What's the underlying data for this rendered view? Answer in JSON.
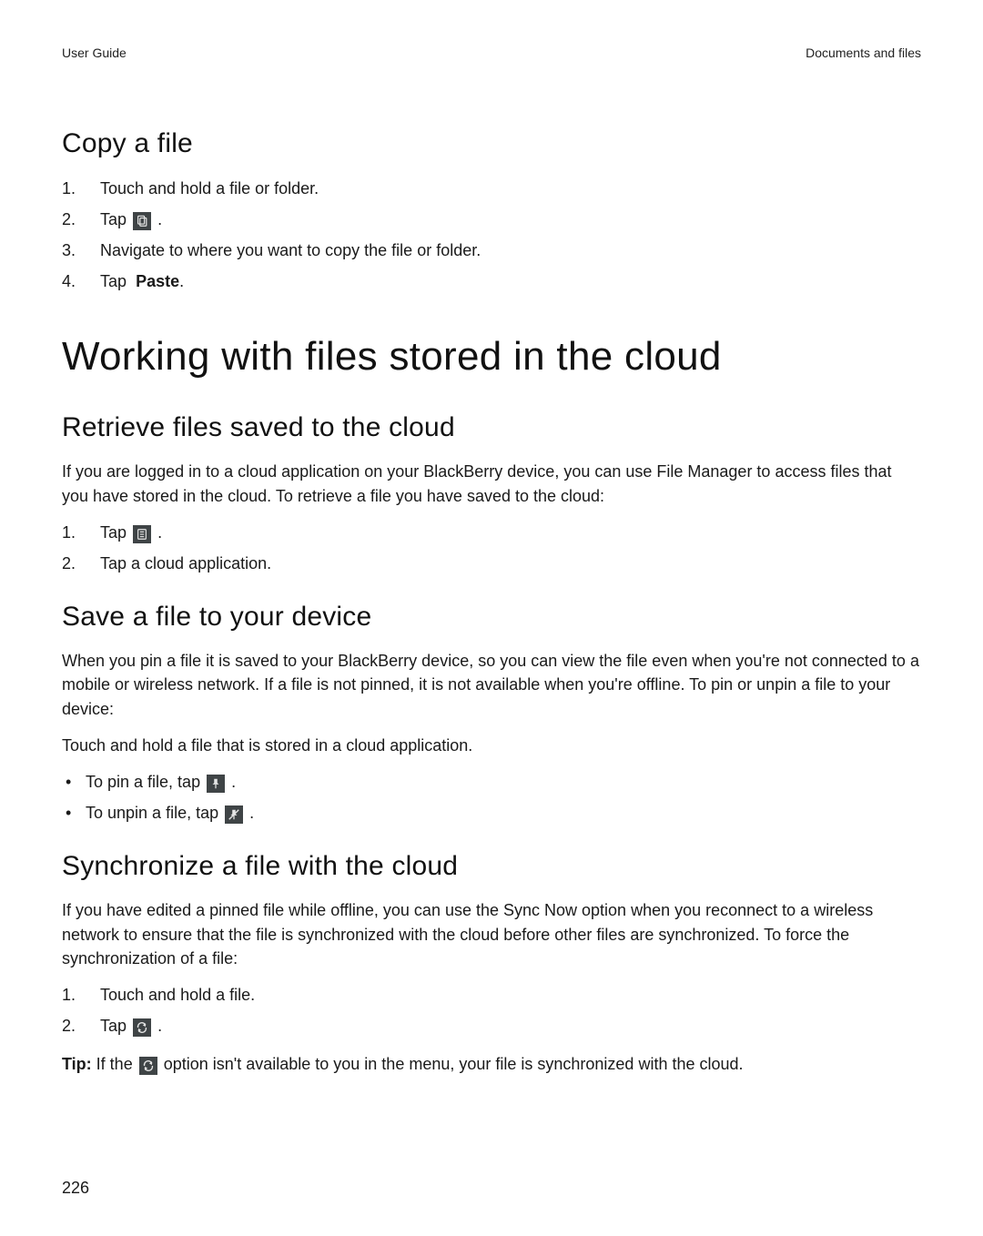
{
  "header": {
    "left": "User Guide",
    "right": "Documents and files"
  },
  "section_copy": {
    "title": "Copy a file",
    "steps": [
      "Touch and hold a file or folder.",
      "Tap",
      "Navigate to where you want to copy the file or folder.",
      "Tap"
    ],
    "step4_bold": "Paste",
    "step4_suffix": "."
  },
  "main": {
    "title": "Working with files stored in the cloud"
  },
  "section_retrieve": {
    "title": "Retrieve files saved to the cloud",
    "para": "If you are logged in to a cloud application on your BlackBerry device, you can use File Manager to access files that you have stored in the cloud. To retrieve a file you have saved to the cloud:",
    "steps": [
      "Tap",
      "Tap a cloud application."
    ]
  },
  "section_save": {
    "title": "Save a file to your device",
    "para": "When you pin a file it is saved to your BlackBerry device, so you can view the file even when you're not connected to a mobile or wireless network. If a file is not pinned, it is not available when you're offline. To pin or unpin a file to your device:",
    "instruction": "Touch and hold a file that is stored in a cloud application.",
    "bullets": [
      "To pin a file, tap",
      "To unpin a file, tap"
    ]
  },
  "section_sync": {
    "title": "Synchronize a file with the cloud",
    "para": "If you have edited a pinned file while offline, you can use the Sync Now option when you reconnect to a wireless network to ensure that the file is synchronized with the cloud before other files are synchronized. To force the synchronization of a file:",
    "steps": [
      "Touch and hold a file.",
      "Tap"
    ],
    "tip_label": "Tip:",
    "tip_before": " If the ",
    "tip_after": " option isn't available to you in the menu, your file is synchronized with the cloud."
  },
  "footer": {
    "page_number": "226"
  }
}
